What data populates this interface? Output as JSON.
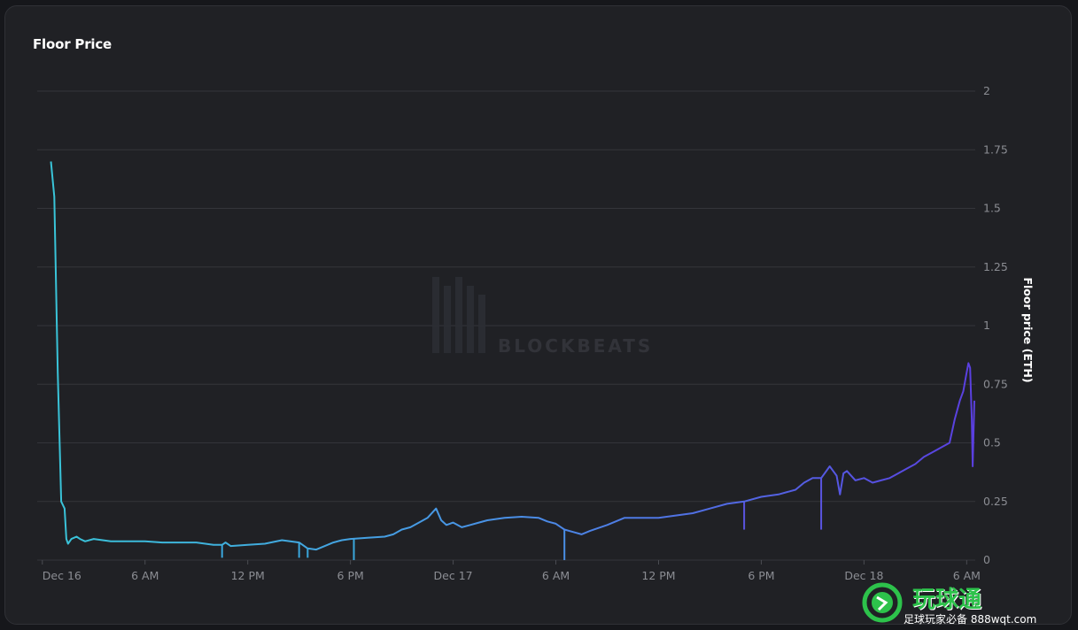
{
  "title": "Floor Price",
  "watermark": {
    "text": "BLOCKBEATS"
  },
  "logo": {
    "title": "玩球通",
    "subtitle": "足球玩家必备 888wqt.com"
  },
  "colors": {
    "line_start": "#39c4d8",
    "line_end": "#5a3fe0",
    "grid": "#34353a"
  },
  "chart_data": {
    "type": "line",
    "title": "Floor Price",
    "xlabel": "",
    "ylabel": "Floor price (ETH)",
    "x_unit": "hours since Dec 16 00:00",
    "xlim": [
      -0.3,
      54.5
    ],
    "ylim": [
      0,
      2
    ],
    "x_ticks": [
      {
        "x": 0,
        "label": "Dec 16"
      },
      {
        "x": 6,
        "label": "6 AM"
      },
      {
        "x": 12,
        "label": "12 PM"
      },
      {
        "x": 18,
        "label": "6 PM"
      },
      {
        "x": 24,
        "label": "Dec 17"
      },
      {
        "x": 30,
        "label": "6 AM"
      },
      {
        "x": 36,
        "label": "12 PM"
      },
      {
        "x": 42,
        "label": "6 PM"
      },
      {
        "x": 48,
        "label": "Dec 18"
      },
      {
        "x": 54,
        "label": "6 AM"
      }
    ],
    "y_ticks": [
      {
        "y": 0,
        "label": "0"
      },
      {
        "y": 0.25,
        "label": "0.25"
      },
      {
        "y": 0.5,
        "label": "0.5"
      },
      {
        "y": 0.75,
        "label": "0.75"
      },
      {
        "y": 1,
        "label": "1"
      },
      {
        "y": 1.25,
        "label": "1.25"
      },
      {
        "y": 1.5,
        "label": "1.5"
      },
      {
        "y": 1.75,
        "label": "1.75"
      },
      {
        "y": 2,
        "label": "2"
      }
    ],
    "grid": true,
    "series": [
      {
        "name": "",
        "points": [
          [
            0.5,
            1.7
          ],
          [
            0.7,
            1.55
          ],
          [
            0.9,
            0.8
          ],
          [
            1.1,
            0.25
          ],
          [
            1.3,
            0.22
          ],
          [
            1.4,
            0.09
          ],
          [
            1.5,
            0.07
          ],
          [
            1.7,
            0.09
          ],
          [
            2.0,
            0.1
          ],
          [
            2.2,
            0.09
          ],
          [
            2.5,
            0.08
          ],
          [
            3.0,
            0.09
          ],
          [
            4.0,
            0.08
          ],
          [
            5.0,
            0.08
          ],
          [
            6.0,
            0.08
          ],
          [
            7.0,
            0.075
          ],
          [
            8.0,
            0.075
          ],
          [
            9.0,
            0.075
          ],
          [
            10.0,
            0.065
          ],
          [
            10.5,
            0.065
          ],
          [
            10.7,
            0.075
          ],
          [
            11.0,
            0.06
          ],
          [
            12.0,
            0.065
          ],
          [
            13.0,
            0.07
          ],
          [
            14.0,
            0.085
          ],
          [
            15.0,
            0.075
          ],
          [
            15.5,
            0.05
          ],
          [
            16.0,
            0.045
          ],
          [
            16.5,
            0.06
          ],
          [
            17.0,
            0.075
          ],
          [
            17.5,
            0.085
          ],
          [
            18.0,
            0.09
          ],
          [
            19.0,
            0.095
          ],
          [
            20.0,
            0.1
          ],
          [
            20.5,
            0.11
          ],
          [
            21.0,
            0.13
          ],
          [
            21.5,
            0.14
          ],
          [
            22.0,
            0.16
          ],
          [
            22.5,
            0.18
          ],
          [
            23.0,
            0.22
          ],
          [
            23.3,
            0.17
          ],
          [
            23.6,
            0.15
          ],
          [
            24.0,
            0.16
          ],
          [
            24.5,
            0.14
          ],
          [
            25.0,
            0.15
          ],
          [
            25.5,
            0.16
          ],
          [
            26.0,
            0.17
          ],
          [
            27.0,
            0.18
          ],
          [
            28.0,
            0.185
          ],
          [
            29.0,
            0.18
          ],
          [
            29.5,
            0.165
          ],
          [
            30.0,
            0.155
          ],
          [
            30.5,
            0.13
          ],
          [
            31.0,
            0.12
          ],
          [
            31.5,
            0.11
          ],
          [
            32.0,
            0.125
          ],
          [
            33.0,
            0.15
          ],
          [
            34.0,
            0.18
          ],
          [
            35.0,
            0.18
          ],
          [
            36.0,
            0.18
          ],
          [
            37.0,
            0.19
          ],
          [
            38.0,
            0.2
          ],
          [
            39.0,
            0.22
          ],
          [
            40.0,
            0.24
          ],
          [
            41.0,
            0.25
          ],
          [
            42.0,
            0.27
          ],
          [
            43.0,
            0.28
          ],
          [
            44.0,
            0.3
          ],
          [
            44.5,
            0.33
          ],
          [
            45.0,
            0.35
          ],
          [
            45.5,
            0.35
          ],
          [
            45.8,
            0.38
          ],
          [
            46.0,
            0.4
          ],
          [
            46.2,
            0.38
          ],
          [
            46.4,
            0.36
          ],
          [
            46.6,
            0.28
          ],
          [
            46.8,
            0.37
          ],
          [
            47.0,
            0.38
          ],
          [
            47.5,
            0.34
          ],
          [
            48.0,
            0.35
          ],
          [
            48.5,
            0.33
          ],
          [
            49.0,
            0.34
          ],
          [
            49.5,
            0.35
          ],
          [
            50.0,
            0.37
          ],
          [
            50.5,
            0.39
          ],
          [
            51.0,
            0.41
          ],
          [
            51.5,
            0.44
          ],
          [
            52.0,
            0.46
          ],
          [
            52.5,
            0.48
          ],
          [
            53.0,
            0.5
          ],
          [
            53.3,
            0.6
          ],
          [
            53.6,
            0.68
          ],
          [
            53.8,
            0.72
          ],
          [
            54.0,
            0.8
          ],
          [
            54.1,
            0.84
          ],
          [
            54.2,
            0.82
          ],
          [
            54.3,
            0.6
          ],
          [
            54.35,
            0.4
          ],
          [
            54.4,
            0.55
          ],
          [
            54.45,
            0.68
          ]
        ],
        "dips": [
          [
            10.5,
            0.01
          ],
          [
            15.0,
            0.01
          ],
          [
            15.5,
            0.01
          ],
          [
            18.2,
            0.0
          ],
          [
            30.5,
            0.0
          ],
          [
            41.0,
            0.13
          ],
          [
            45.5,
            0.13
          ]
        ]
      }
    ]
  }
}
